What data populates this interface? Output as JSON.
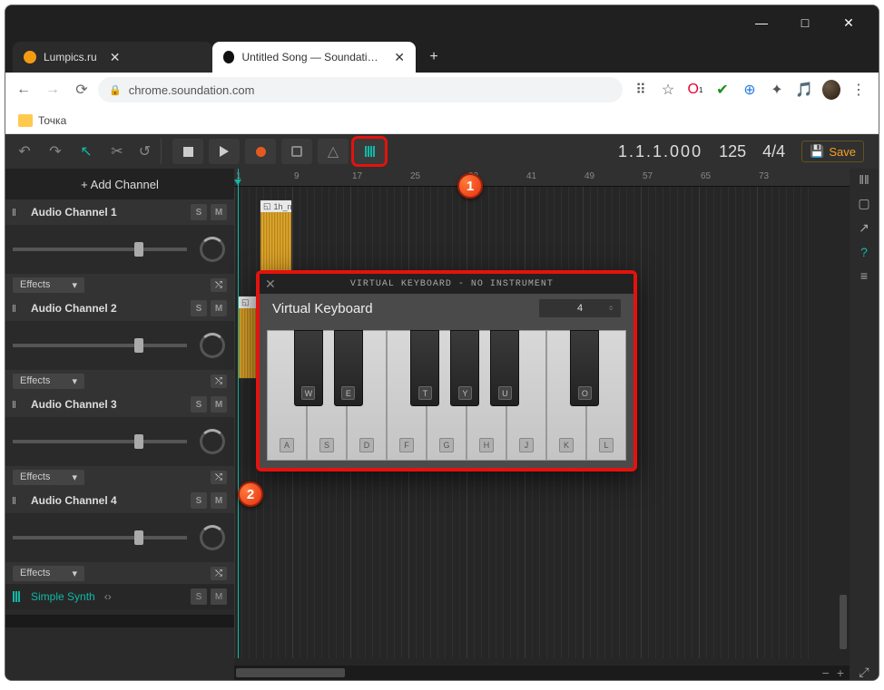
{
  "window": {
    "min": "—",
    "max": "□",
    "close": "✕"
  },
  "tabs": {
    "inactive": {
      "label": "Lumpics.ru",
      "icon_color": "#f39c12",
      "close": "✕"
    },
    "active": {
      "label": "Untitled Song — Soundation Stu",
      "close": "✕"
    },
    "new": "+"
  },
  "address": {
    "url": "chrome.soundation.com"
  },
  "bookmarks": {
    "item": "Точка"
  },
  "toolbar": {
    "position": "1.1.1.000",
    "tempo": "125",
    "sig": "4/4",
    "save": "Save"
  },
  "channels": {
    "add": "+ Add Channel",
    "list": [
      {
        "name": "Audio Channel 1",
        "s": "S",
        "m": "M",
        "effects": "Effects"
      },
      {
        "name": "Audio Channel 2",
        "s": "S",
        "m": "M",
        "effects": "Effects"
      },
      {
        "name": "Audio Channel 3",
        "s": "S",
        "m": "M",
        "effects": "Effects"
      },
      {
        "name": "Audio Channel 4",
        "s": "S",
        "m": "M",
        "effects": "Effects"
      }
    ],
    "synth": {
      "name": "Simple Synth",
      "s": "S",
      "m": "M"
    }
  },
  "ruler": [
    "1",
    "9",
    "17",
    "25",
    "33",
    "41",
    "49",
    "57",
    "65",
    "73"
  ],
  "clips": {
    "c1": "1h_n"
  },
  "vkb": {
    "title": "VIRTUAL KEYBOARD - NO INSTRUMENT",
    "label": "Virtual Keyboard",
    "octave": "4",
    "white": [
      "A",
      "S",
      "D",
      "F",
      "G",
      "H",
      "J",
      "K",
      "L"
    ],
    "black": [
      "W",
      "E",
      "",
      "T",
      "Y",
      "U",
      "",
      "O",
      ""
    ]
  },
  "markers": {
    "m1": "1",
    "m2": "2"
  }
}
